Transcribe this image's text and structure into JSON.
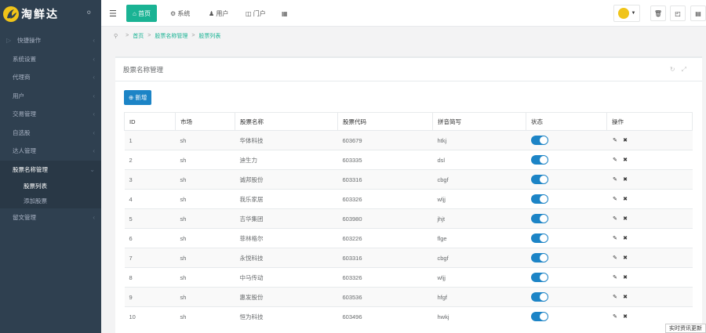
{
  "brand": {
    "name": "淘鲜达"
  },
  "sidebar": {
    "items": [
      {
        "label": "快捷操作"
      },
      {
        "label": "系统设置"
      },
      {
        "label": "代理商"
      },
      {
        "label": "用户"
      },
      {
        "label": "交易管理"
      },
      {
        "label": "自选股"
      },
      {
        "label": "达人管理"
      },
      {
        "label": "股票名称管理"
      },
      {
        "label": "股票列表"
      },
      {
        "label": "添加股票"
      },
      {
        "label": "留文管理"
      }
    ]
  },
  "topbar": {
    "home": "首页",
    "system": "系统",
    "user": "用户",
    "portal": "门户"
  },
  "breadcrumb": {
    "home": "首页",
    "section": "股票名称管理",
    "page": "股票列表"
  },
  "panel": {
    "title": "股票名称管理",
    "add_label": "新增"
  },
  "table": {
    "headers": [
      "ID",
      "市场",
      "股票名称",
      "股票代码",
      "拼音简写",
      "状态",
      "操作"
    ],
    "rows": [
      {
        "id": "1",
        "market": "sh",
        "name": "华体科技",
        "code": "603679",
        "pinyin": "htkj"
      },
      {
        "id": "2",
        "market": "sh",
        "name": "迪生力",
        "code": "603335",
        "pinyin": "dsl"
      },
      {
        "id": "3",
        "market": "sh",
        "name": "诚邦股份",
        "code": "603316",
        "pinyin": "cbgf"
      },
      {
        "id": "4",
        "market": "sh",
        "name": "我乐家居",
        "code": "603326",
        "pinyin": "wljj"
      },
      {
        "id": "5",
        "market": "sh",
        "name": "吉华集团",
        "code": "603980",
        "pinyin": "jhjt"
      },
      {
        "id": "6",
        "market": "sh",
        "name": "菲林格尔",
        "code": "603226",
        "pinyin": "flge"
      },
      {
        "id": "7",
        "market": "sh",
        "name": "永悦科技",
        "code": "603316",
        "pinyin": "cbgf"
      },
      {
        "id": "8",
        "market": "sh",
        "name": "中马传动",
        "code": "603326",
        "pinyin": "wljj"
      },
      {
        "id": "9",
        "market": "sh",
        "name": "惠发股份",
        "code": "603536",
        "pinyin": "hfgf"
      },
      {
        "id": "10",
        "market": "sh",
        "name": "恒为科技",
        "code": "603496",
        "pinyin": "hwkj"
      }
    ]
  },
  "ticker": "实时资讯更新"
}
